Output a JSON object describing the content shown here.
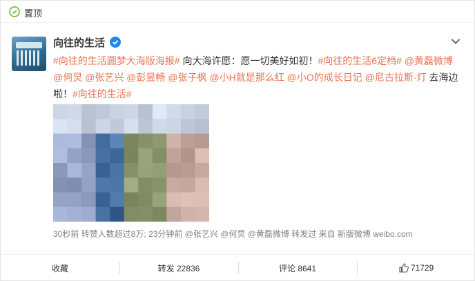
{
  "topbar": {
    "label": "置顶"
  },
  "post": {
    "username": "向往的生活",
    "content": [
      {
        "type": "tag",
        "text": "#向往的生活圆梦大海版海报#"
      },
      {
        "type": "text",
        "text": " 向大海许愿：愿一切美好如初！"
      },
      {
        "type": "tag",
        "text": "#向往的生活6定档#"
      },
      {
        "type": "text",
        "text": " "
      },
      {
        "type": "tag",
        "text": "@黄磊微博"
      },
      {
        "type": "text",
        "text": " "
      },
      {
        "type": "tag",
        "text": "@何炅"
      },
      {
        "type": "text",
        "text": " "
      },
      {
        "type": "tag",
        "text": "@张艺兴"
      },
      {
        "type": "text",
        "text": " "
      },
      {
        "type": "tag",
        "text": "@彭昱畅"
      },
      {
        "type": "text",
        "text": " "
      },
      {
        "type": "tag",
        "text": "@张子枫"
      },
      {
        "type": "text",
        "text": " "
      },
      {
        "type": "tag",
        "text": "@小H就是那么红"
      },
      {
        "type": "text",
        "text": " "
      },
      {
        "type": "tag",
        "text": "@小O的成长日记"
      },
      {
        "type": "text",
        "text": " "
      },
      {
        "type": "tag",
        "text": "@尼古拉斯·灯"
      },
      {
        "type": "text",
        "text": " 去海边啦！"
      },
      {
        "type": "tag",
        "text": "#向往的生活#"
      }
    ],
    "meta": "30秒前 转赞人数超过8万; 23分钟前 @张艺兴 @何炅 @黄磊微博 转发过  来自 新版微博 weibo.com"
  },
  "actions": {
    "favorite": "收藏",
    "repost": "转发 22836",
    "comment": "评论 8641",
    "like": "71729"
  },
  "colors": {
    "link": "#eb7350",
    "pin": "#7ac143",
    "verified": "#1e88e5"
  },
  "icons": [
    "pin-icon",
    "verified-icon",
    "chevron-down-icon",
    "like-icon"
  ]
}
